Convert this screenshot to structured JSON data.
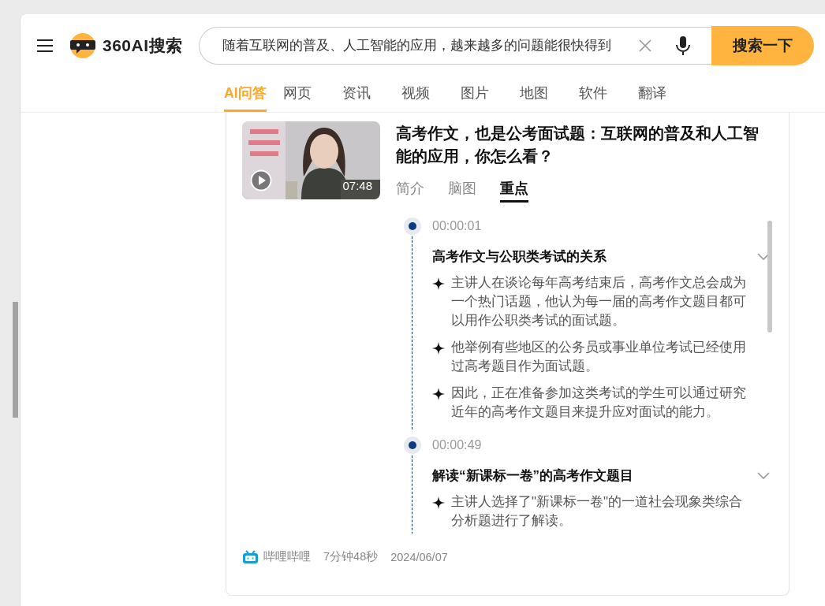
{
  "header": {
    "logo_text": "360AI搜索",
    "search": {
      "value": "随着互联网的普及、人工智能的应用，越来越多的问题能很快得到"
    },
    "search_button": "搜索一下"
  },
  "nav_tabs": [
    {
      "label": "AI问答",
      "selected": true
    },
    {
      "label": "网页",
      "selected": false
    },
    {
      "label": "资讯",
      "selected": false
    },
    {
      "label": "视频",
      "selected": false
    },
    {
      "label": "图片",
      "selected": false
    },
    {
      "label": "地图",
      "selected": false
    },
    {
      "label": "软件",
      "selected": false
    },
    {
      "label": "翻译",
      "selected": false
    }
  ],
  "result": {
    "video": {
      "kind": "picture",
      "duration": "07:48"
    },
    "title": "高考作文，也是公考面试题：互联网的普及和人工智能的应用，你怎么看？",
    "tabs": [
      {
        "label": "简介",
        "selected": false
      },
      {
        "label": "脑图",
        "selected": false
      },
      {
        "label": "重点",
        "selected": true
      }
    ],
    "timeline": [
      {
        "time": "00:00:01",
        "title": "高考作文与公职类考试的关系",
        "points": [
          "主讲人在谈论每年高考结束后，高考作文总会成为一个热门话题，他认为每一届的高考作文题目都可以用作公职类考试的面试题。",
          "他举例有些地区的公务员或事业单位考试已经使用过高考题目作为面试题。",
          "因此，正在准备参加这类考试的学生可以通过研究近年的高考作文题目来提升应对面试的能力。"
        ]
      },
      {
        "time": "00:00:49",
        "title": "解读“新课标一卷”的高考作文题目",
        "points": [
          "主讲人选择了\"新课标一卷\"的一道社会现象类综合分析题进行了解读。"
        ]
      }
    ],
    "source": "哔哩哔哩",
    "length": "7分钟48秒",
    "date": "2024/06/07"
  }
}
